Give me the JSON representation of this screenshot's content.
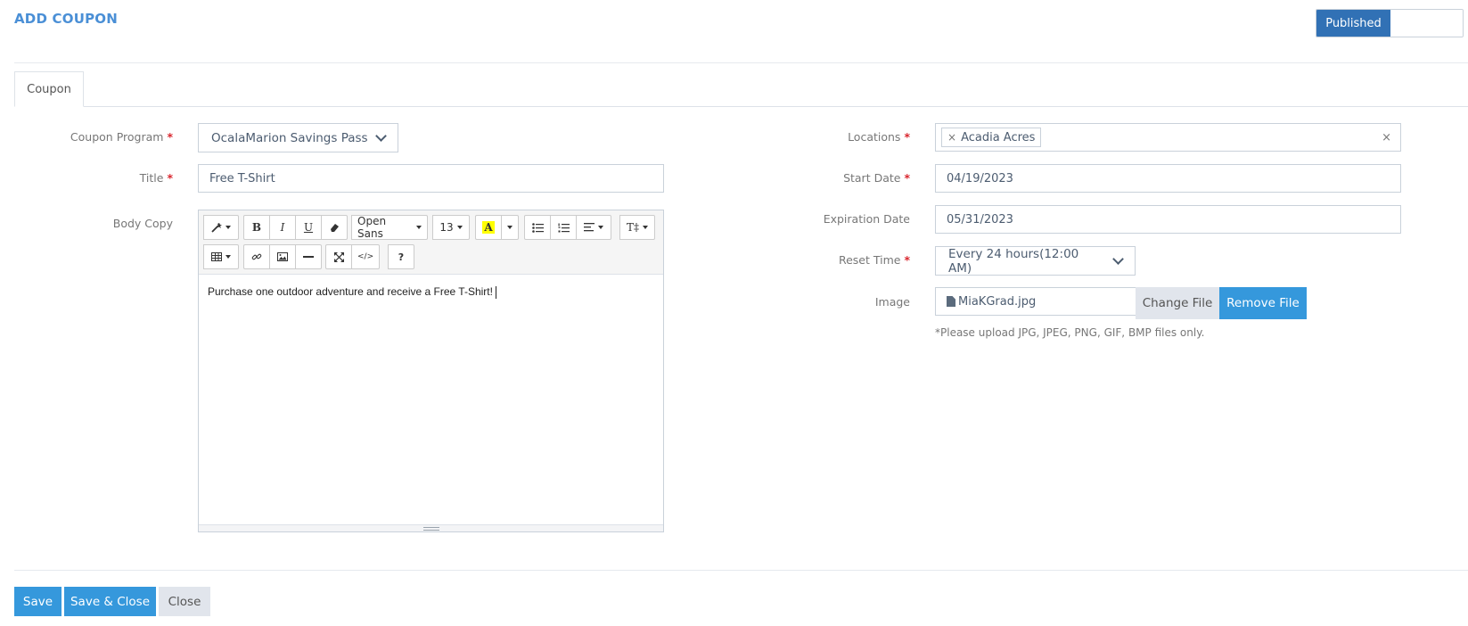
{
  "page": {
    "title": "ADD COUPON"
  },
  "publish": {
    "on_label": "Published",
    "off_label": ""
  },
  "tabs": [
    {
      "label": "Coupon"
    }
  ],
  "form": {
    "coupon_program": {
      "label": "Coupon Program",
      "value": "OcalaMarion Savings Pass"
    },
    "title": {
      "label": "Title",
      "value": "Free T-Shirt"
    },
    "body_copy": {
      "label": "Body Copy",
      "value": "Purchase one outdoor adventure and receive a Free T-Shirt!"
    },
    "locations": {
      "label": "Locations",
      "tags": [
        "Acadia Acres"
      ],
      "clear": "×",
      "tag_remove": "×"
    },
    "start_date": {
      "label": "Start Date",
      "value": "04/19/2023"
    },
    "expiration_date": {
      "label": "Expiration Date",
      "value": "05/31/2023"
    },
    "reset_time": {
      "label": "Reset Time",
      "value": "Every 24 hours(12:00 AM)"
    },
    "image": {
      "label": "Image",
      "file_name": "MiaKGrad.jpg",
      "change_label": "Change File",
      "remove_label": "Remove File",
      "hint": "*Please upload JPG, JPEG, PNG, GIF, BMP files only."
    },
    "required_mark": "*"
  },
  "editor_toolbar": {
    "bold": "B",
    "italic": "I",
    "underline": "U",
    "font_family": "Open Sans",
    "font_size": "13",
    "highlight": "A",
    "height": "T‡",
    "code": "</>",
    "help": "?"
  },
  "actions": {
    "save": "Save",
    "save_close": "Save & Close",
    "close": "Close"
  },
  "colors": {
    "accent": "#3598dc",
    "published": "#3171b5",
    "title": "#4a8fd6",
    "required": "#d9262e",
    "highlight": "#ffff00"
  }
}
